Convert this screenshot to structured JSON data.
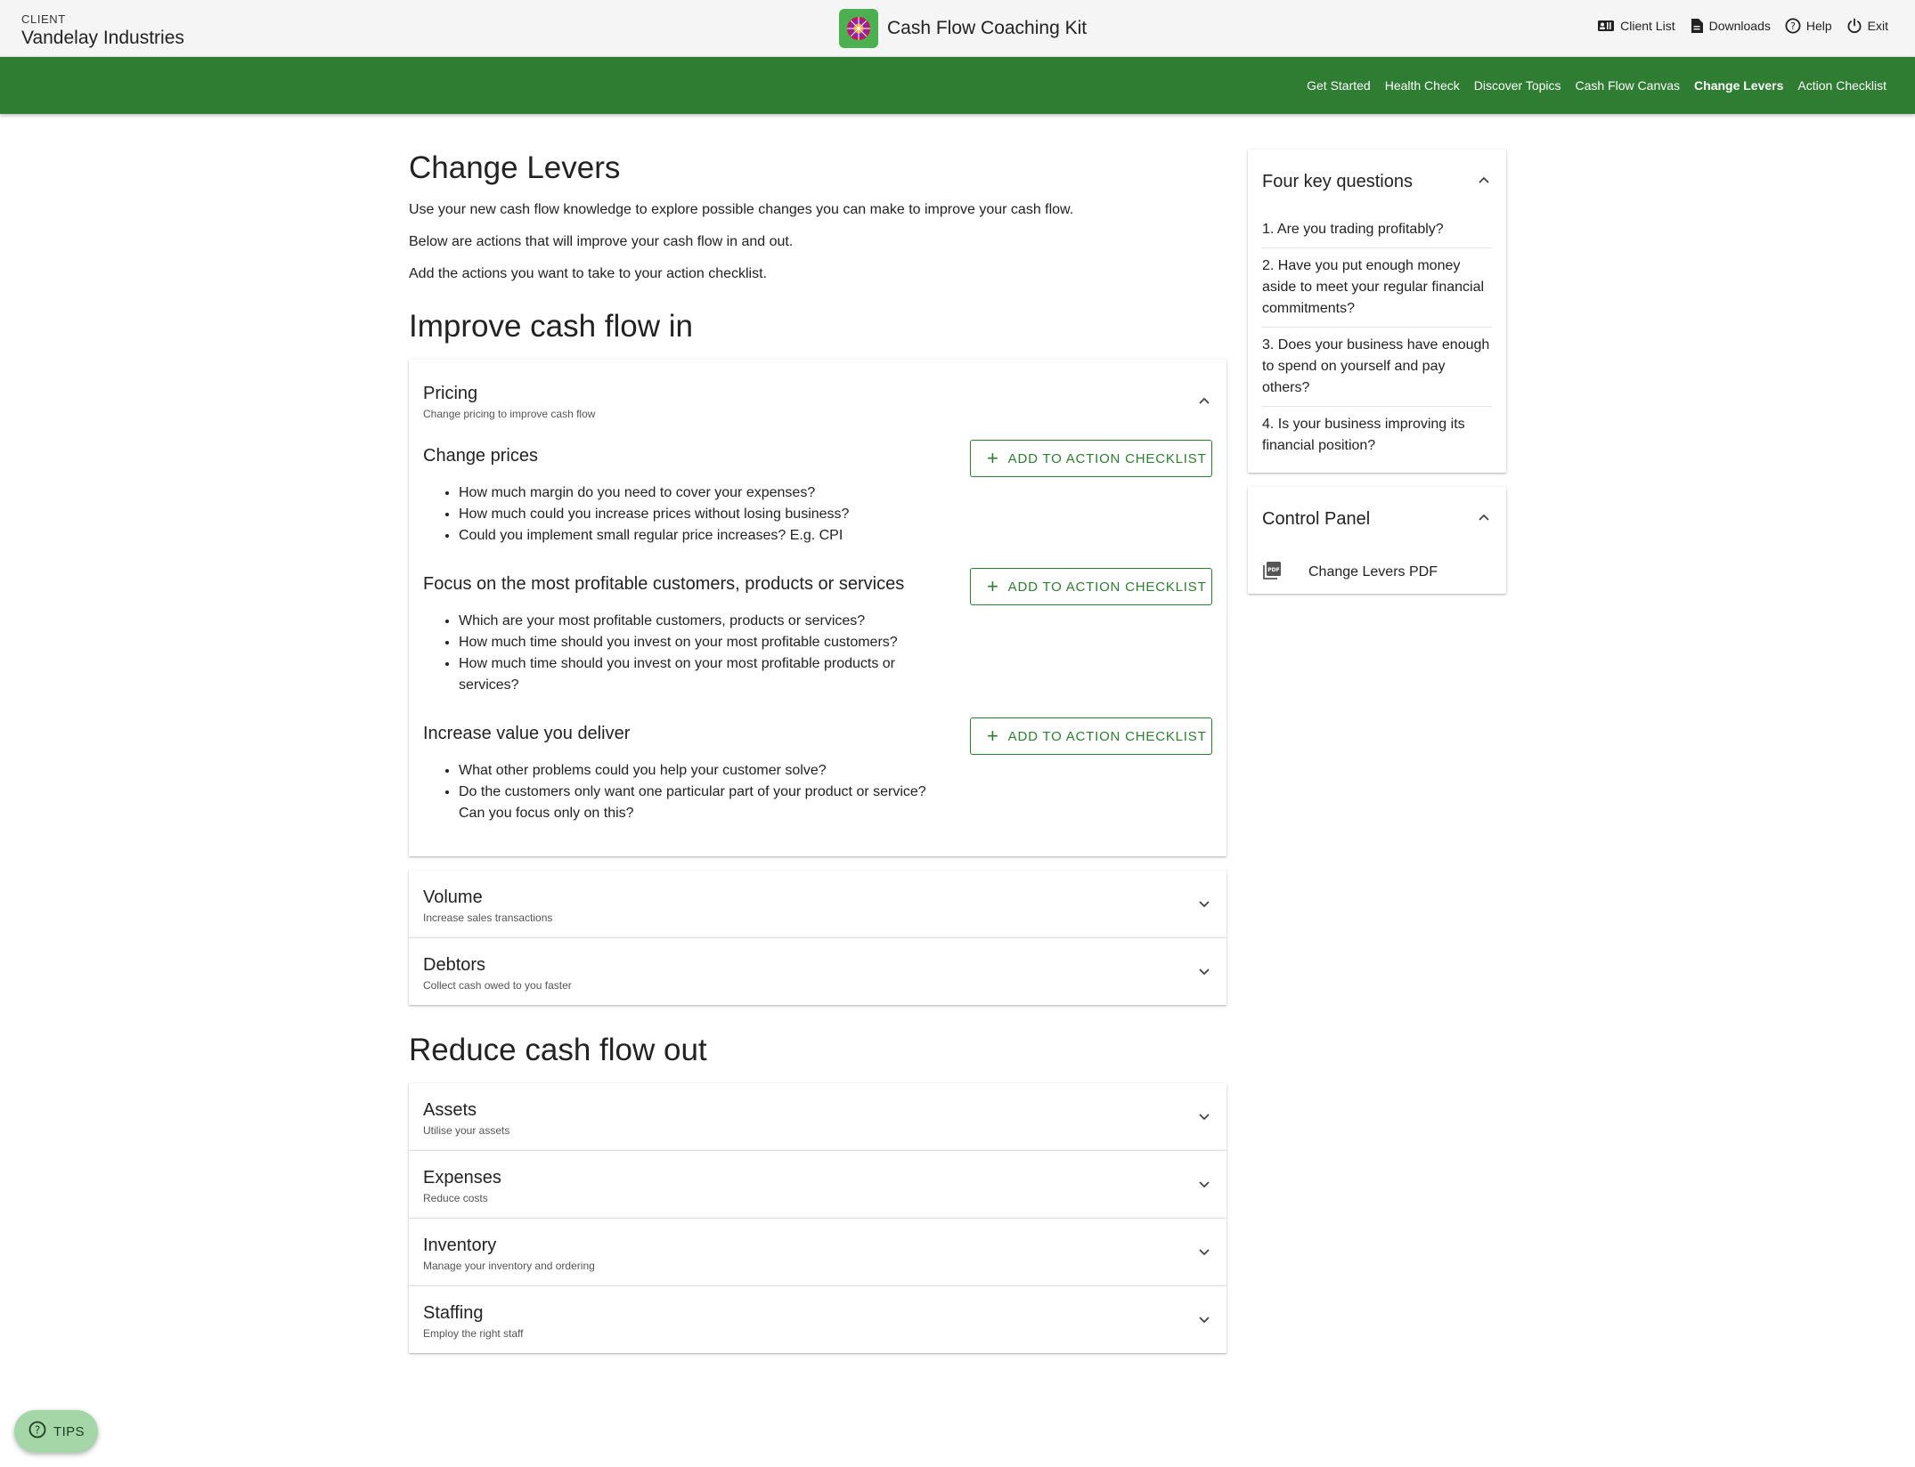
{
  "client": {
    "label": "CLIENT",
    "name": "Vandelay Industries"
  },
  "app": {
    "title": "Cash Flow Coaching Kit"
  },
  "top_actions": [
    {
      "label": "Client List",
      "icon": "contact-card-icon"
    },
    {
      "label": "Downloads",
      "icon": "document-icon"
    },
    {
      "label": "Help",
      "icon": "help-circle-icon"
    },
    {
      "label": "Exit",
      "icon": "power-icon"
    }
  ],
  "nav": {
    "tabs": [
      "Get Started",
      "Health Check",
      "Discover Topics",
      "Cash Flow Canvas",
      "Change Levers",
      "Action Checklist"
    ],
    "active": "Change Levers"
  },
  "page": {
    "title": "Change Levers",
    "intro": [
      "Use your new cash flow knowledge to explore possible changes you can make to improve your cash flow.",
      "Below are actions that will improve your cash flow in and out.",
      "Add the actions you want to take to your action checklist."
    ]
  },
  "improve": {
    "title": "Improve cash flow in",
    "pricing": {
      "title": "Pricing",
      "subtitle": "Change pricing to improve cash flow",
      "expanded": true,
      "levers": [
        {
          "title": "Change prices",
          "button": "ADD TO ACTION CHECKLIST",
          "bullets": [
            "How much margin do you need to cover your expenses?",
            "How much could you increase prices without losing business?",
            "Could you implement small regular price increases? E.g. CPI"
          ]
        },
        {
          "title": "Focus on the most profitable customers, products or services",
          "button": "ADD TO ACTION CHECKLIST",
          "bullets": [
            "Which are your most profitable customers, products or services?",
            "How much time should you invest on your most profitable customers?",
            "How much time should you invest on your most profitable products or services?"
          ]
        },
        {
          "title": "Increase value you deliver",
          "button": "ADD TO ACTION CHECKLIST",
          "bullets": [
            "What other problems could you help your customer solve?",
            "Do the customers only want one particular part of your product or service? Can you focus only on this?"
          ]
        }
      ]
    },
    "volume": {
      "title": "Volume",
      "subtitle": "Increase sales transactions"
    },
    "debtors": {
      "title": "Debtors",
      "subtitle": "Collect cash owed to you faster"
    }
  },
  "reduce": {
    "title": "Reduce cash flow out",
    "assets": {
      "title": "Assets",
      "subtitle": "Utilise your assets"
    },
    "expenses": {
      "title": "Expenses",
      "subtitle": "Reduce costs"
    },
    "inventory": {
      "title": "Inventory",
      "subtitle": "Manage your inventory and ordering"
    },
    "staffing": {
      "title": "Staffing",
      "subtitle": "Employ the right staff"
    }
  },
  "sidebar": {
    "questions": {
      "title": "Four key questions",
      "items": [
        "1. Are you trading profitably?",
        "2. Have you put enough money aside to meet your regular financial commitments?",
        "3. Does your business have enough to spend on yourself and pay others?",
        "4. Is your business improving its financial position?"
      ]
    },
    "control": {
      "title": "Control Panel",
      "pdf_label": "Change Levers PDF"
    }
  },
  "tips": {
    "label": "TIPS"
  },
  "colors": {
    "brand_green": "#2e7d32",
    "tips_green": "#a5d6a7",
    "topbar": "#f5f5f5"
  }
}
